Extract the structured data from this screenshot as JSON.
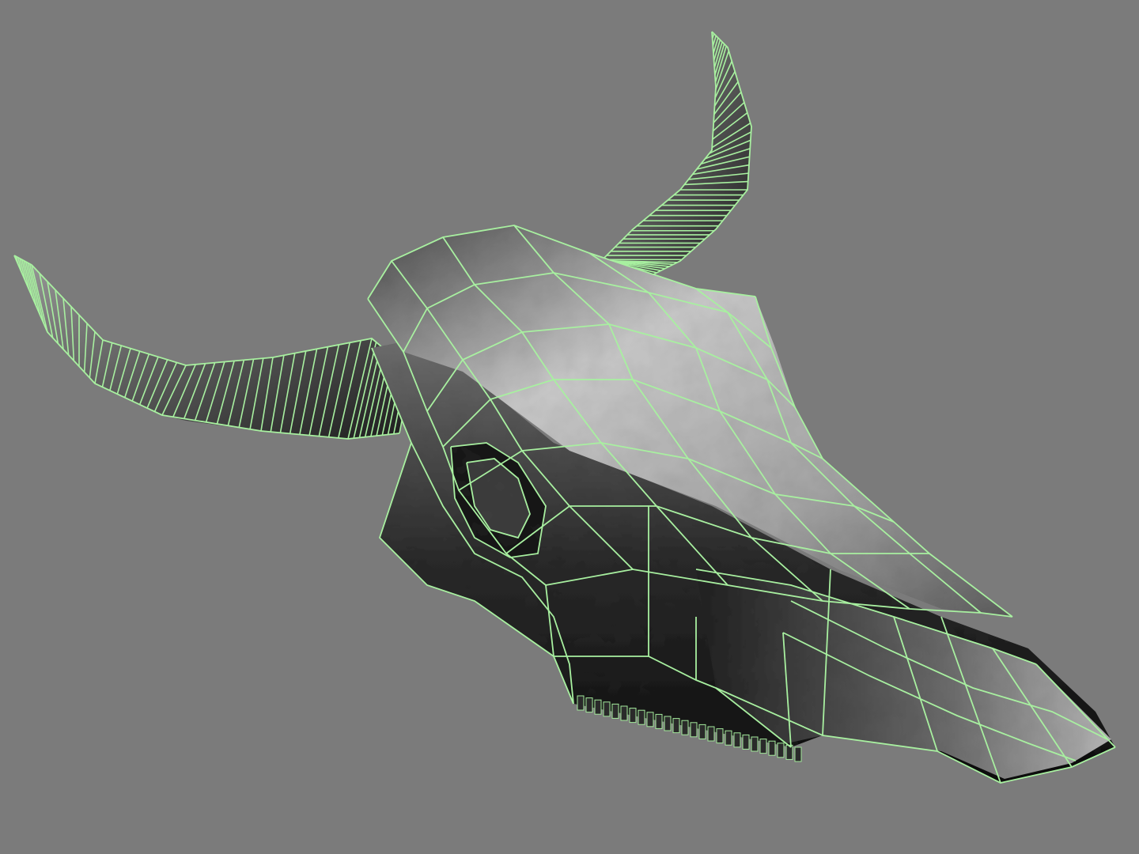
{
  "viewport": {
    "background_color": "#7b7b7b",
    "wireframe_color": "#a8f0a0",
    "selection_state": "selected"
  },
  "model": {
    "object": "cow-skull",
    "display_mode": "textured-with-wireframe-on-shaded"
  }
}
